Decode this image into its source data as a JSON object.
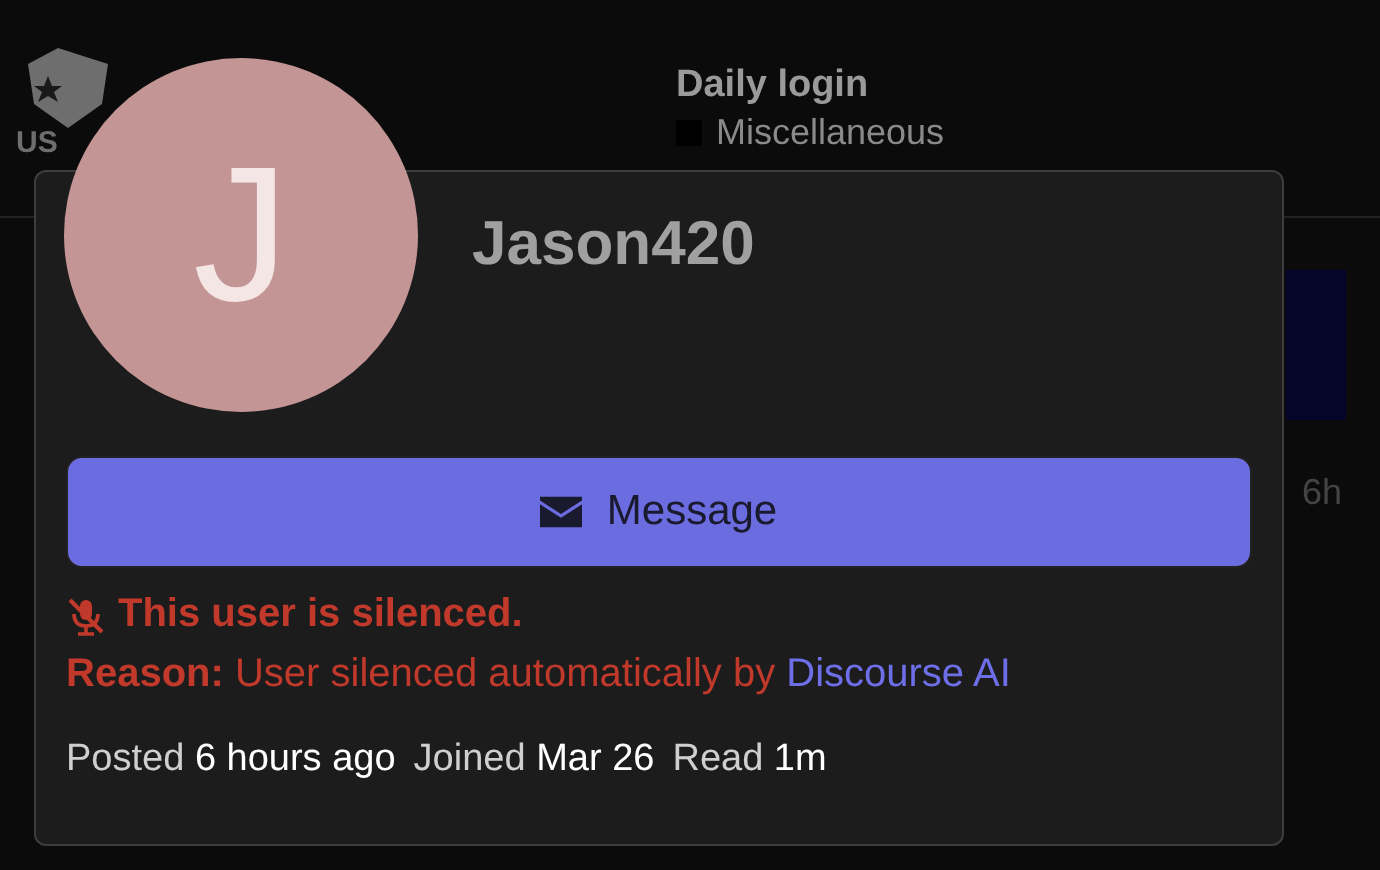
{
  "background": {
    "logo_text": "US",
    "topic_title": "Daily login",
    "category": {
      "name": "Miscellaneous",
      "color": "#000000"
    },
    "age": "6h"
  },
  "user_card": {
    "avatar_letter": "J",
    "username": "Jason420",
    "message_button": "Message",
    "silenced": {
      "title": "This user is silenced.",
      "reason_label": "Reason:",
      "reason_text": "User silenced automatically by",
      "reason_link": "Discourse AI"
    },
    "stats": [
      {
        "label": "Posted",
        "value": "6 hours ago"
      },
      {
        "label": "Joined",
        "value": "Mar 26"
      },
      {
        "label": "Read",
        "value": "1m"
      }
    ]
  }
}
